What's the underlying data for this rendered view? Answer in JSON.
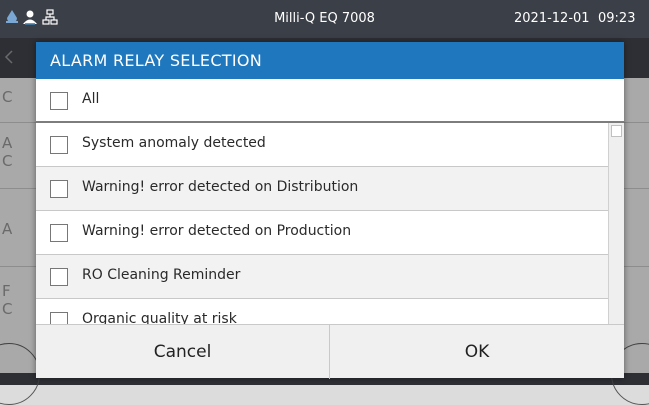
{
  "statusbar": {
    "title": "Milli-Q EQ 7008",
    "date": "2021-12-01",
    "time": "09:23",
    "icons": [
      "drop-icon",
      "user-icon",
      "network-icon"
    ]
  },
  "background": {
    "letters": [
      "C",
      "A",
      "C",
      "A",
      "F",
      "C"
    ]
  },
  "dialog": {
    "title": "ALARM RELAY SELECTION",
    "all_label": "All",
    "items": [
      "System anomaly detected",
      "Warning! error detected on Distribution",
      "Warning! error detected on Production",
      "RO Cleaning Reminder",
      "Organic quality at risk"
    ],
    "cancel_label": "Cancel",
    "ok_label": "OK"
  },
  "colors": {
    "header": "#1f77bd",
    "statusbar": "#3b3f47"
  }
}
